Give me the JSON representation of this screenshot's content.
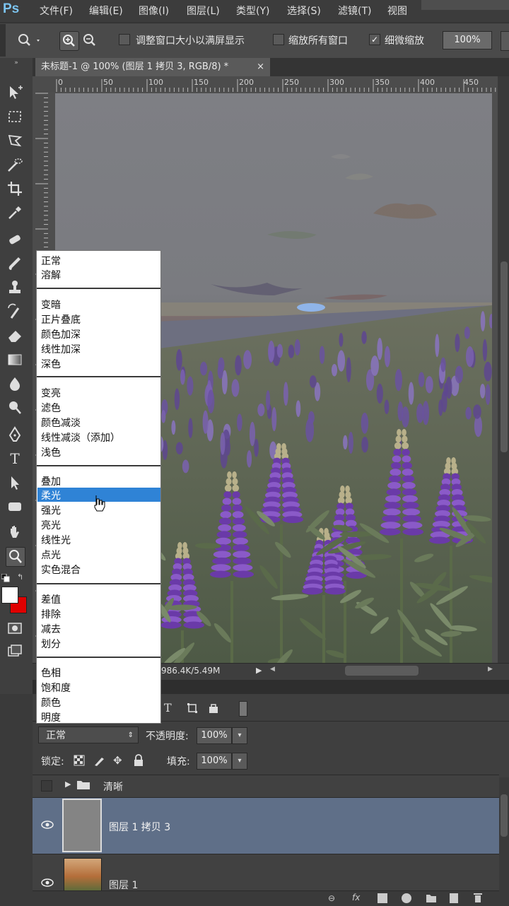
{
  "app": {
    "logo": "Ps"
  },
  "menubar": {
    "items": [
      "文件(F)",
      "编辑(E)",
      "图像(I)",
      "图层(L)",
      "类型(Y)",
      "选择(S)",
      "滤镜(T)",
      "视图"
    ]
  },
  "options": {
    "fit_window_label": "调整窗口大小以满屏显示",
    "zoom_all_label": "缩放所有窗口",
    "scrubby_zoom_label": "细微缩放",
    "scrubby_zoom_checked": true,
    "zoom_value": "100%"
  },
  "document": {
    "tab_title": "未标题-1 @ 100% (图层 1 拷贝 3, RGB/8) *",
    "close": "×",
    "doc_size": "986.4K/5.49M",
    "ruler_ticks": [
      "0",
      "50",
      "100",
      "150",
      "200",
      "250",
      "300",
      "350",
      "400",
      "450"
    ]
  },
  "blend_menu": {
    "groups": [
      [
        "正常",
        "溶解"
      ],
      [
        "变暗",
        "正片叠底",
        "颜色加深",
        "线性加深",
        "深色"
      ],
      [
        "变亮",
        "滤色",
        "颜色减淡",
        "线性减淡（添加）",
        "浅色"
      ],
      [
        "叠加",
        "柔光",
        "强光",
        "亮光",
        "线性光",
        "点光",
        "实色混合"
      ],
      [
        "差值",
        "排除",
        "减去",
        "划分"
      ],
      [
        "色相",
        "饱和度",
        "颜色",
        "明度"
      ]
    ],
    "highlighted": "柔光"
  },
  "layers_panel": {
    "blend_mode": "正常",
    "opacity_label": "不透明度:",
    "opacity_value": "100%",
    "lock_label": "锁定:",
    "fill_label": "填充:",
    "fill_value": "100%",
    "group_name": "清晰",
    "layers": [
      "图层 1 拷贝 3",
      "图层 1"
    ],
    "selected_layer": "图层 1 拷贝 3"
  },
  "colors": {
    "foreground": "#ffffff",
    "background": "#e00000",
    "highlight": "#2f83d6",
    "selected_layer_bg": "#5f6f88"
  }
}
